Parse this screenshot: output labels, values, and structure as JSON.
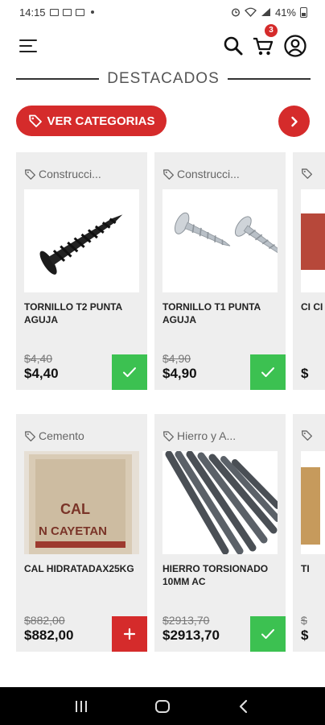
{
  "status_bar": {
    "time": "14:15",
    "battery": "41%"
  },
  "header": {
    "cart_count": "3"
  },
  "section": {
    "title": "DESTACADOS"
  },
  "categories_button": {
    "label": "VER CATEGORIAS"
  },
  "products": [
    {
      "category": "Construcci...",
      "name": "TORNILLO T2 PUNTA AGUJA",
      "old_price": "$4,40",
      "price": "$4,40",
      "in_cart": true
    },
    {
      "category": "Construcci...",
      "name": "TORNILLO T1 PUNTA AGUJA",
      "old_price": "$4,90",
      "price": "$4,90",
      "in_cart": true
    },
    {
      "category": "",
      "name": "CI CI",
      "old_price": "",
      "price": "$",
      "in_cart": false
    },
    {
      "category": "Cemento",
      "name": "CAL HIDRATADAX25KG",
      "old_price": "$882,00",
      "price": "$882,00",
      "in_cart": false
    },
    {
      "category": "Hierro y A...",
      "name": "HIERRO TORSIONADO 10MM AC",
      "old_price": "$2913,70",
      "price": "$2913,70",
      "in_cart": true
    },
    {
      "category": "",
      "name": "TI",
      "old_price": "$",
      "price": "$",
      "in_cart": false
    }
  ],
  "colors": {
    "accent": "#d52b2b",
    "success": "#3cc151",
    "card_bg": "#eeeeee"
  }
}
